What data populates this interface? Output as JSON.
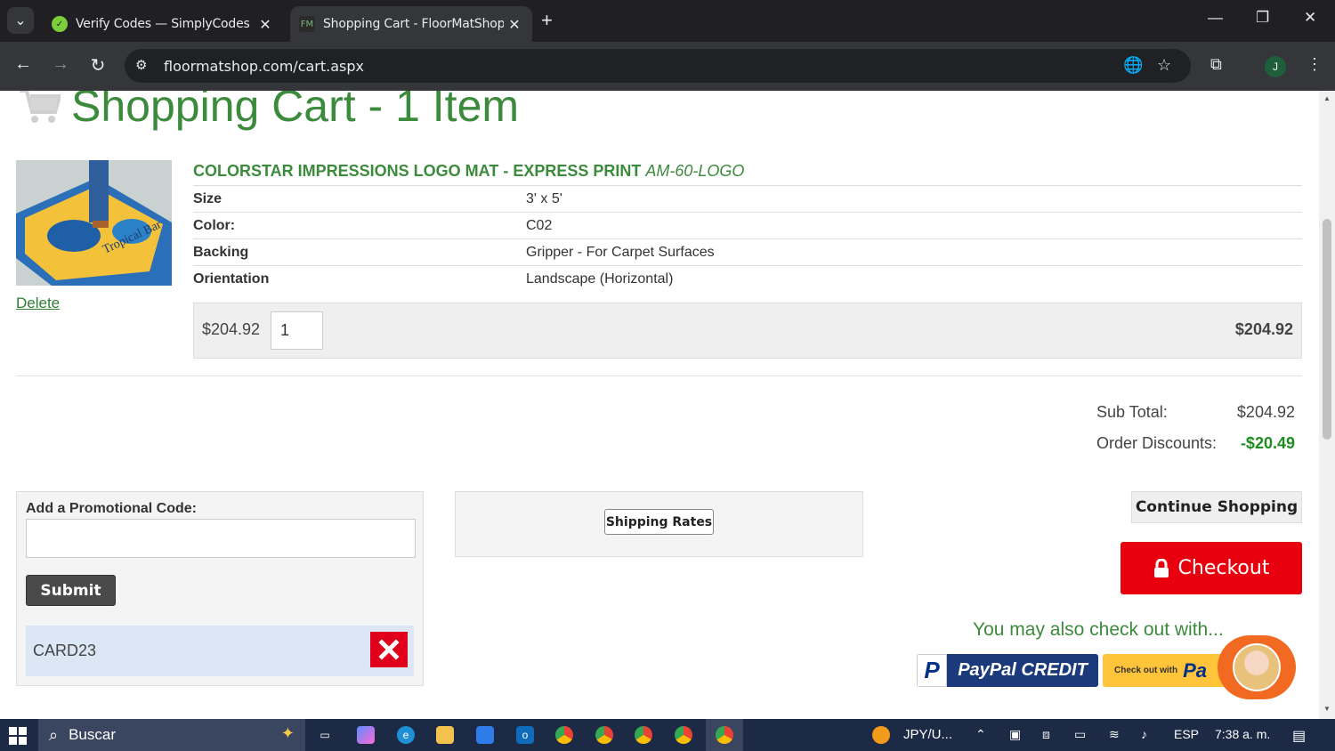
{
  "browser": {
    "tabs": [
      {
        "title": "Verify Codes — SimplyCodes",
        "active": false
      },
      {
        "title": "Shopping Cart - FloorMatShop",
        "active": true
      }
    ],
    "url": "floormatshop.com/cart.aspx",
    "profile_initial": "J"
  },
  "cart": {
    "title": "Shopping Cart - 1 Item",
    "product": {
      "name": "COLORSTAR IMPRESSIONS LOGO MAT - EXPRESS PRINT",
      "sku": "AM-60-LOGO",
      "attributes": [
        {
          "key": "Size",
          "value": "3' x 5'"
        },
        {
          "key": "Color:",
          "value": "C02"
        },
        {
          "key": "Backing",
          "value": "Gripper - For Carpet Surfaces"
        },
        {
          "key": "Orientation",
          "value": "Landscape (Horizontal)"
        }
      ],
      "unit_price": "$204.92",
      "quantity": "1",
      "line_total": "$204.92",
      "delete_label": "Delete"
    },
    "totals": {
      "subtotal_label": "Sub Total:",
      "subtotal_value": "$204.92",
      "discount_label": "Order Discounts:",
      "discount_value": "-$20.49"
    },
    "promo": {
      "label": "Add a Promotional Code:",
      "input_value": "",
      "submit_label": "Submit",
      "applied_code": "CARD23"
    },
    "shipping_rates_label": "Shipping Rates",
    "continue_label": "Continue Shopping",
    "checkout_label": "Checkout",
    "also_checkout_text": "You may also check out with...",
    "paypal_credit_label": "PayPal CREDIT",
    "paypal_checkout_small": "Check out with",
    "paypal_checkout_logo": "Pa"
  },
  "taskbar": {
    "search_label": "Buscar",
    "ticker": "JPY/U...",
    "language": "ESP",
    "time": "7:38 a. m."
  },
  "colors": {
    "brand_green": "#3c8a3c",
    "checkout_red": "#e8000f",
    "discount_green": "#1f8c1f"
  }
}
